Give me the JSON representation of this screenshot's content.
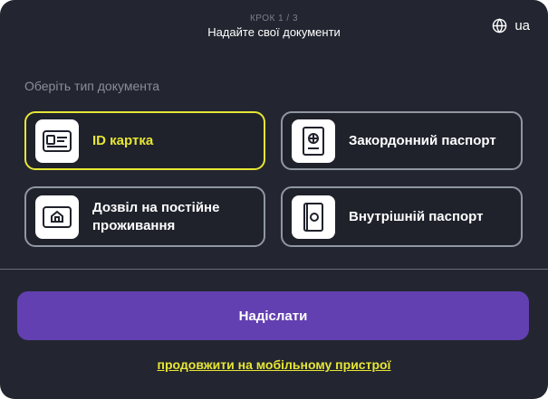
{
  "header": {
    "step": "КРОК 1 / 3",
    "title": "Надайте свої документи",
    "language": "ua",
    "language_icon": "globe-icon"
  },
  "section_label": "Оберіть тип документа",
  "documents": [
    {
      "label": "ID картка",
      "icon": "id-card-icon",
      "selected": true
    },
    {
      "label": "Закордонний паспорт",
      "icon": "passport-icon",
      "selected": false
    },
    {
      "label": "Дозвіл на постійне проживання",
      "icon": "residence-permit-icon",
      "selected": false
    },
    {
      "label": "Внутрішній паспорт",
      "icon": "internal-passport-icon",
      "selected": false
    }
  ],
  "submit_label": "Надіслати",
  "mobile_link": "продовжити на мобільному пристрої",
  "colors": {
    "background": "#232630",
    "accent": "#e7e634",
    "button": "#6240b1",
    "card_border": "#9097a3"
  }
}
